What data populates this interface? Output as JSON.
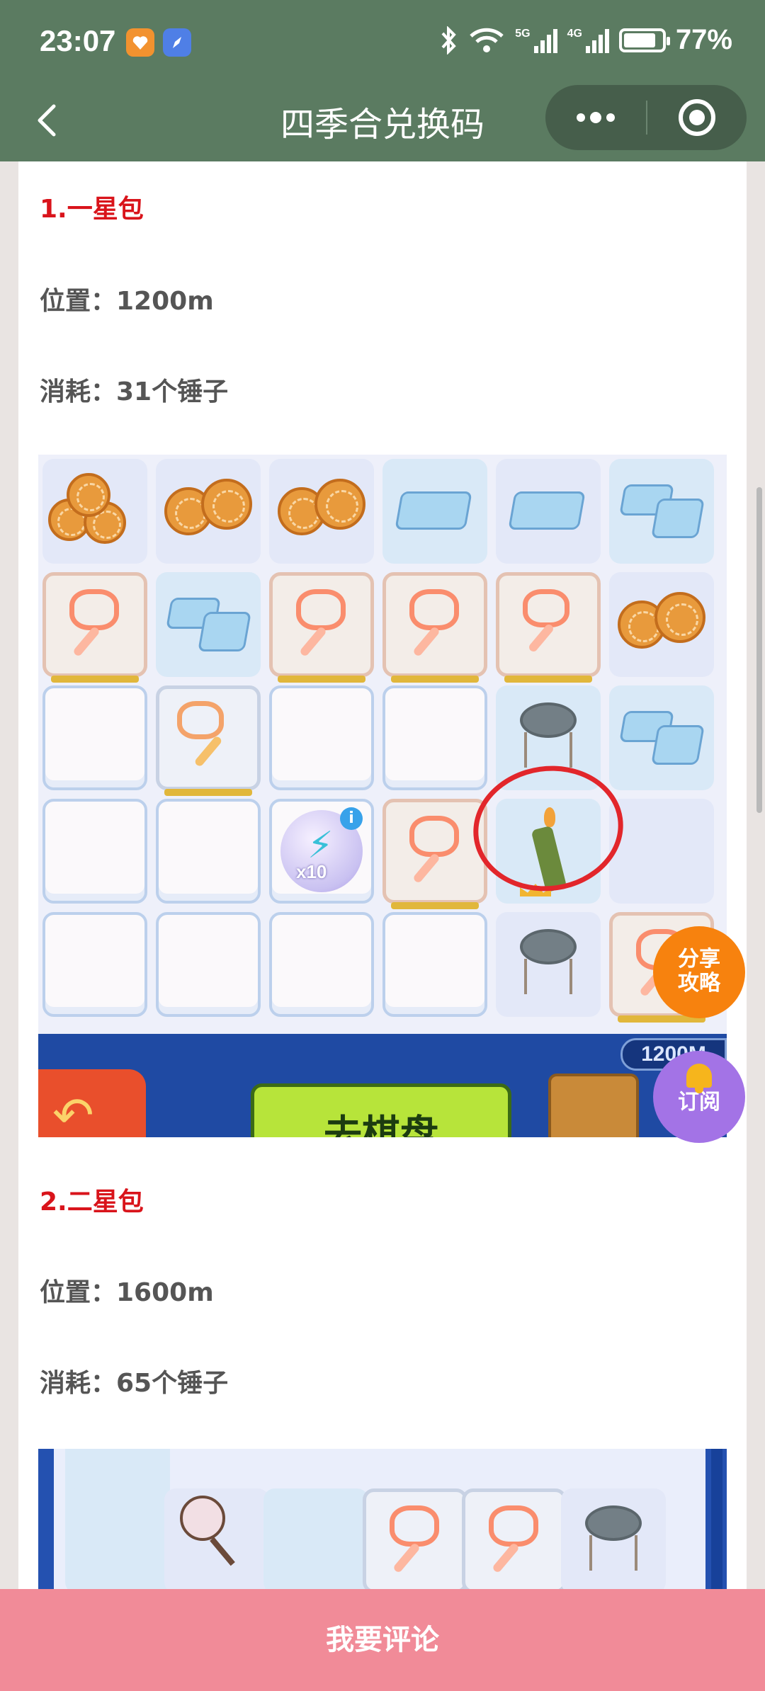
{
  "status_bar": {
    "time": "23:07",
    "battery": "77%",
    "battery_level": 0.77,
    "network_1": "5G",
    "network_2": "4G",
    "icons": [
      "heart-app-icon",
      "compass-app-icon",
      "bluetooth-icon",
      "wifi-icon",
      "signal-icon",
      "battery-icon"
    ]
  },
  "header": {
    "title": "四季合兑换码",
    "background": "#5b7b61"
  },
  "sections": [
    {
      "title": "1.一星包",
      "position": "位置：1200m",
      "cost": "消耗：31个锤子",
      "screenshot": {
        "distance_badge": "1200M",
        "energy_quantity": "x10",
        "main_button": "去棋盘"
      }
    },
    {
      "title": "2.二星包",
      "position": "位置：1600m",
      "cost": "消耗：65个锤子"
    }
  ],
  "floating": {
    "share_label": "分享攻略",
    "subscribe_label": "订阅"
  },
  "footer": {
    "comment_label": "我要评论"
  },
  "colors": {
    "accent_red": "#d9141b",
    "comment_bar": "#f18b98",
    "share_button": "#f7820e",
    "subscribe_button": "#a373e6"
  }
}
